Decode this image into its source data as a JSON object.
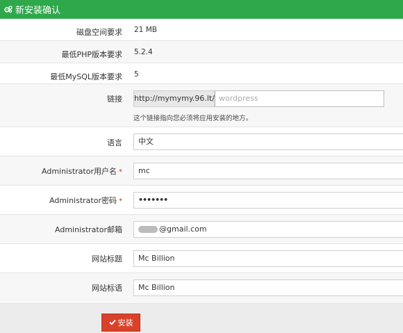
{
  "header": {
    "title": "新安装确认",
    "icon": "gears-icon"
  },
  "requirements": [
    {
      "label": "磁盘空间要求",
      "value": "21 MB"
    },
    {
      "label": "最低PHP版本要求",
      "value": "5.2.4"
    },
    {
      "label": "最低MySQL版本要求",
      "value": "5"
    }
  ],
  "link": {
    "label": "链接",
    "url_prefix": "http://mymymy.96.lt/",
    "directory_placeholder": "wordpress",
    "help": "这个链接指向您必须将应用安装的地方。"
  },
  "language": {
    "label": "语言",
    "value": "中文"
  },
  "admin_username": {
    "label": "Administrator用户名",
    "value": "mc",
    "required_mark": "*"
  },
  "admin_password": {
    "label": "Administrator密码",
    "value": "•••••••",
    "required_mark": "*"
  },
  "admin_email": {
    "label": "Administrator邮箱",
    "value": "@gmail.com"
  },
  "site_title": {
    "label": "网站标题",
    "value": "Mc Billion"
  },
  "site_tagline": {
    "label": "网站标语",
    "value": "Mc Billion"
  },
  "install_button": {
    "label": "安装",
    "icon": "check-icon"
  },
  "colors": {
    "header_bg": "#2ea84b",
    "button_bg": "#d9422a"
  }
}
